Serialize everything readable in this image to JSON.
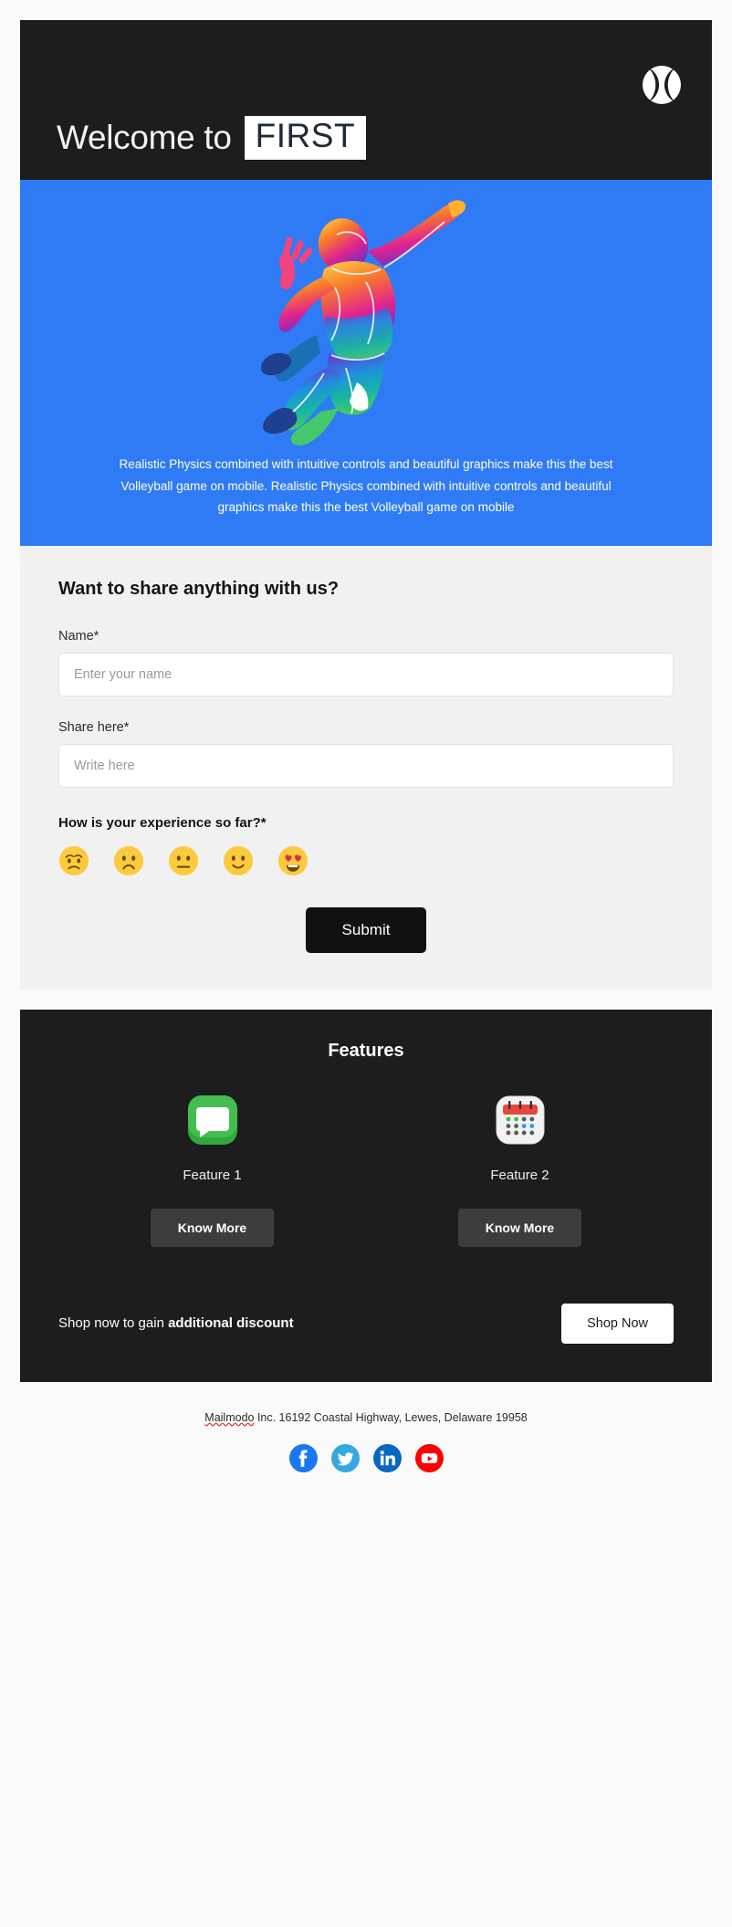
{
  "header": {
    "welcome_text": "Welcome to",
    "brand_badge": "FIRST",
    "ball_icon": "baseball-icon",
    "bg_color": "#1d1d1d"
  },
  "hero": {
    "bg_color": "#2f7bf6",
    "illustration": "volleyball-player-jumping-illustration",
    "body_text": "Realistic Physics combined with intuitive controls and beautiful graphics make this the best Volleyball game on mobile. Realistic Physics combined with intuitive controls and beautiful graphics make this the best Volleyball game on mobile"
  },
  "form": {
    "title": "Want to share anything with us?",
    "name_label": "Name*",
    "name_placeholder": "Enter your name",
    "name_value": "",
    "share_label": "Share here*",
    "share_placeholder": "Write here",
    "share_value": "",
    "rating_label": "How is your experience so far?*",
    "ratings": [
      {
        "name": "emoji-disappointed",
        "glyph": "😔"
      },
      {
        "name": "emoji-frowning",
        "glyph": "🙁"
      },
      {
        "name": "emoji-neutral",
        "glyph": "😐"
      },
      {
        "name": "emoji-slightly-smiling",
        "glyph": "🙂"
      },
      {
        "name": "emoji-heart-eyes",
        "glyph": "😍"
      }
    ],
    "submit_label": "Submit"
  },
  "features": {
    "title": "Features",
    "items": [
      {
        "icon": "green-message-bubble-icon",
        "label": "Feature 1",
        "button": "Know More"
      },
      {
        "icon": "calendar-icon",
        "label": "Feature 2",
        "button": "Know More"
      }
    ],
    "promo_text_plain": "Shop now to gain ",
    "promo_text_bold": "additional discount",
    "promo_button": "Shop Now"
  },
  "footer": {
    "company": "Mailmodo",
    "address": " Inc. 16192 Coastal Highway, Lewes, Delaware 19958",
    "socials": [
      {
        "name": "facebook-icon",
        "color": "#1877F2"
      },
      {
        "name": "twitter-icon",
        "color": "#34A9E0"
      },
      {
        "name": "linkedin-icon",
        "color": "#0A66C2"
      },
      {
        "name": "youtube-icon",
        "color": "#FF0000"
      }
    ]
  }
}
